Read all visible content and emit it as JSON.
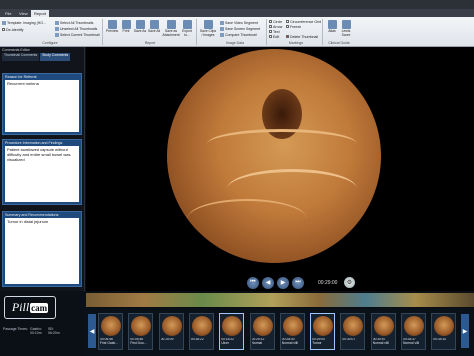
{
  "title_bar": "",
  "menu": {
    "tabs": [
      "File",
      "View",
      "Report"
    ],
    "active": "Report"
  },
  "ribbon": {
    "template_label": "Template: Imaging (HO...",
    "de_identify": "De-Identify",
    "select_all_thumbnails": "Select All Thumbnails",
    "unselect_all_thumbnails": "Unselect All Thumbnails",
    "select_current_thumbnail": "Select Current Thumbnail",
    "configure_label": "Configure",
    "buttons": [
      {
        "label": "Preview"
      },
      {
        "label": "Print"
      },
      {
        "label": "Save As"
      },
      {
        "label": "Save All"
      },
      {
        "label": "Save as Attachment"
      },
      {
        "label": "Export to..."
      },
      {
        "label": "Save Clips / Images"
      }
    ],
    "report_label": "Report",
    "image_data_label": "Image Data",
    "save_video_segment": "Save Video Segment",
    "save_screen_segment": "Save Screen Segment",
    "compare_thumbnail": "Compare Thumbnail",
    "markings": [
      "Circle",
      "Arrow",
      "Text",
      "Edit"
    ],
    "circumference_grid": "Circumference Grid",
    "freeze": "Freeze",
    "delete_thumbnail": "Delete Thumbnail",
    "markings_label": "Markings",
    "atlas": "Atlas",
    "lewis_score": "Lewis Score",
    "clinical_guide_label": "Clinical Guide"
  },
  "sidebar": {
    "title": "Comments Editor",
    "tabs": [
      "Thumbnail Comments",
      "Study Comments"
    ],
    "active_tab": "Study Comments",
    "sections": [
      {
        "header": "Reason for Referral:",
        "text": "Recurrent melena"
      },
      {
        "header": "Procedure Information and Findings:",
        "text": "Patient swallowed capsule without difficulty and entire small bowel was visualized"
      },
      {
        "header": "Summary and Recommendations:",
        "text": "Tumor in distal jejunum"
      }
    ]
  },
  "player": {
    "timecode": "00:29:00"
  },
  "brand": {
    "logo_text": "Pill",
    "logo_badge": "cam"
  },
  "passage": {
    "label": "Passage Times:",
    "gastric_label": "Gastric:",
    "gastric_value": "00:10m",
    "sb_label": "SB:",
    "sb_value": "06:20m"
  },
  "thumbnails": [
    {
      "time": "00:05:46",
      "label": "First Gastr..."
    },
    {
      "time": "00:05:46",
      "label": "First Duo..."
    },
    {
      "time": "00:15:09",
      "label": ""
    },
    {
      "time": "00:18:22",
      "label": ""
    },
    {
      "time": "00:18:22",
      "label": "Ulcer"
    },
    {
      "time": "00:25:12",
      "label": "Normal"
    },
    {
      "time": "00:28:00",
      "label": "Normal villi"
    },
    {
      "time": "00:29:00",
      "label": "Tumor"
    },
    {
      "time": "00:30:07",
      "label": ""
    },
    {
      "time": "00:30:57",
      "label": "Normal villi"
    },
    {
      "time": "00:33:37",
      "label": "Normal villi"
    },
    {
      "time": "00:34:10",
      "label": ""
    }
  ]
}
